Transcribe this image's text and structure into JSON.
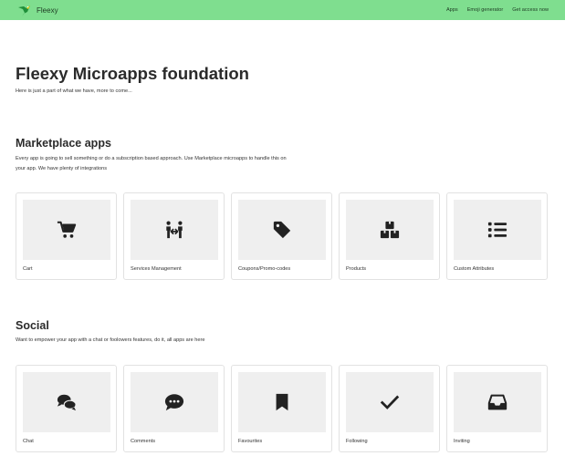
{
  "navbar": {
    "brand_name": "Fleexy",
    "links": [
      "Apps",
      "Emoji generator",
      "Get access now"
    ],
    "background": "#7fde8f"
  },
  "hero": {
    "title": "Fleexy Microapps foundation",
    "subtitle": "Here is just a part of what we have, more to come..."
  },
  "sections": [
    {
      "title": "Marketplace apps",
      "description": "Every app is going to sell something or do a subscription based approach. Use Marketplace microapps to handle this on your app. We have plenty of integrations",
      "cards": [
        {
          "label": "Cart",
          "icon": "cart-icon"
        },
        {
          "label": "Services Management",
          "icon": "people-exchange-icon"
        },
        {
          "label": "Coupons/Promo-codes",
          "icon": "tag-icon"
        },
        {
          "label": "Products",
          "icon": "boxes-icon"
        },
        {
          "label": "Custom Attributes",
          "icon": "list-icon"
        }
      ]
    },
    {
      "title": "Social",
      "description": "Want to empower your app with a chat or foolowers features, do it, all apps are here",
      "cards": [
        {
          "label": "Chat",
          "icon": "chat-bubbles-icon"
        },
        {
          "label": "Comments",
          "icon": "comment-icon"
        },
        {
          "label": "Favourites",
          "icon": "bookmark-icon"
        },
        {
          "label": "Following",
          "icon": "check-icon"
        },
        {
          "label": "Inviting",
          "icon": "inbox-icon"
        }
      ]
    }
  ]
}
